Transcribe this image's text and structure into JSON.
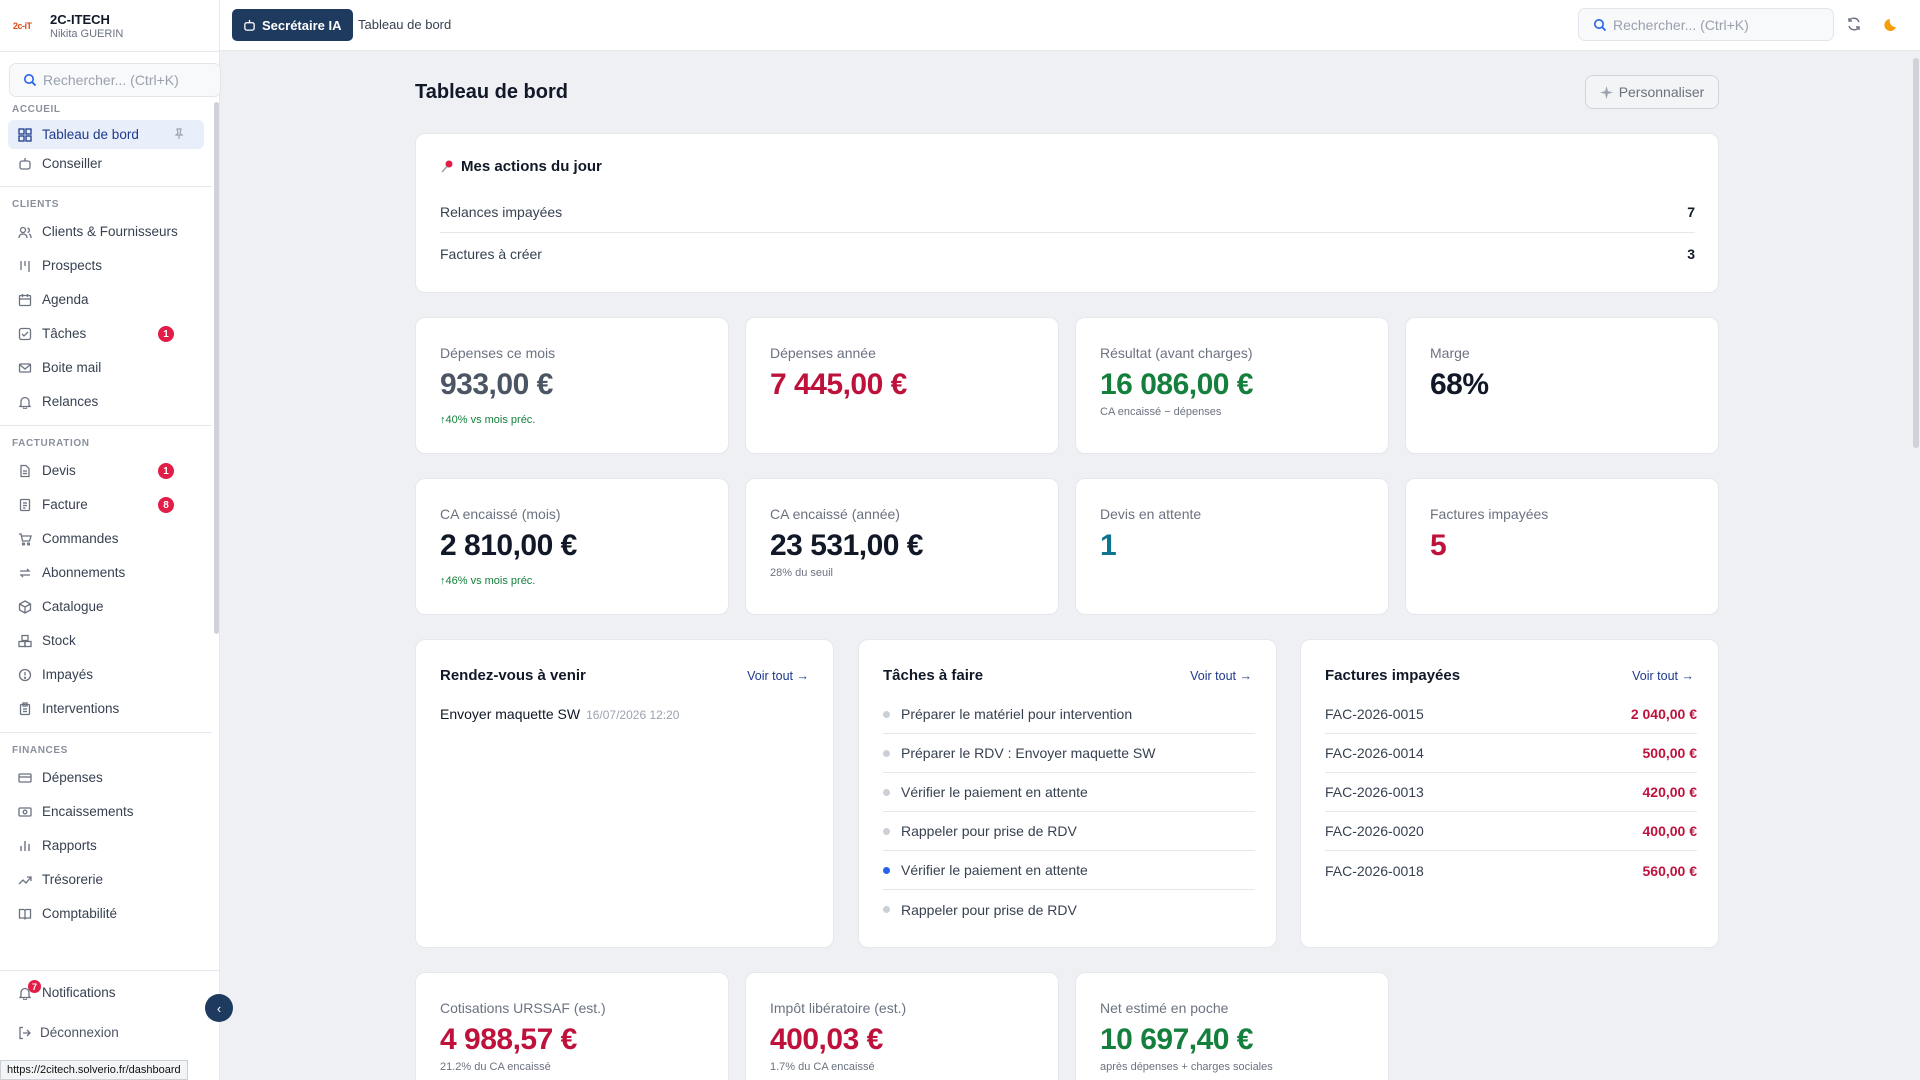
{
  "brand": {
    "name": "2C-ITECH",
    "user": "Nikita GUERIN",
    "logo": "2c-iT"
  },
  "sidebar": {
    "search_placeholder": "Rechercher... (Ctrl+K)",
    "sections": {
      "accueil": "Accueil",
      "clients": "Clients",
      "facturation": "Facturation",
      "finances": "Finances"
    },
    "items": {
      "tableau": "Tableau de bord",
      "conseiller": "Conseiller",
      "clients": "Clients & Fournisseurs",
      "prospects": "Prospects",
      "agenda": "Agenda",
      "taches": "Tâches",
      "taches_badge": "1",
      "boite": "Boite mail",
      "relances": "Relances",
      "devis": "Devis",
      "devis_badge": "1",
      "facture": "Facture",
      "facture_badge": "8",
      "commandes": "Commandes",
      "abonnements": "Abonnements",
      "catalogue": "Catalogue",
      "stock": "Stock",
      "impayes": "Impayés",
      "interventions": "Interventions",
      "depenses": "Dépenses",
      "encaissements": "Encaissements",
      "rapports": "Rapports",
      "tresorerie": "Trésorerie",
      "comptabilite": "Comptabilité"
    },
    "notifications": "Notifications",
    "notifications_badge": "7",
    "logout": "Déconnexion",
    "collapse": "‹"
  },
  "status_url": "https://2citech.solverio.fr/dashboard",
  "topbar": {
    "ai_button": "Secrétaire IA",
    "breadcrumb": "Tableau de bord",
    "search_placeholder": "Rechercher... (Ctrl+K)"
  },
  "main": {
    "title": "Tableau de bord",
    "customize": "Personnaliser",
    "actions": {
      "title": "Mes actions du jour",
      "rows": [
        {
          "label": "Relances impayées",
          "count": "7"
        },
        {
          "label": "Factures à créer",
          "count": "3"
        }
      ]
    },
    "kpis": [
      {
        "label": "Dépenses ce mois",
        "value": "933,00 €",
        "sub": "↑40% vs mois préc."
      },
      {
        "label": "Dépenses année",
        "value": "7 445,00 €",
        "sub": ""
      },
      {
        "label": "Résultat (avant charges)",
        "value": "16 086,00 €",
        "sub": "CA encaissé − dépenses"
      },
      {
        "label": "Marge",
        "value": "68%",
        "sub": ""
      },
      {
        "label": "CA encaissé (mois)",
        "value": "2 810,00 €",
        "sub": "↑46% vs mois préc."
      },
      {
        "label": "CA encaissé (année)",
        "value": "23 531,00 €",
        "sub": "28% du seuil"
      },
      {
        "label": "Devis en attente",
        "value": "1",
        "sub": ""
      },
      {
        "label": "Factures impayées",
        "value": "5",
        "sub": ""
      }
    ],
    "appointments": {
      "title": "Rendez-vous à venir",
      "see_all": "Voir tout →",
      "items": [
        {
          "label": "Envoyer maquette SW",
          "date": "16/07/2026 12:20"
        }
      ]
    },
    "tasks": {
      "title": "Tâches à faire",
      "see_all": "Voir tout →",
      "items": [
        "Préparer le matériel pour intervention",
        "Préparer le RDV : Envoyer maquette SW",
        "Vérifier le paiement en attente",
        "Rappeler pour prise de RDV",
        "Vérifier le paiement en attente",
        "Rappeler pour prise de RDV"
      ]
    },
    "unpaid": {
      "title": "Factures impayées",
      "see_all": "Voir tout →",
      "items": [
        {
          "ref": "FAC-2026-0015",
          "amount": "2 040,00 €"
        },
        {
          "ref": "FAC-2026-0014",
          "amount": "500,00 €"
        },
        {
          "ref": "FAC-2026-0013",
          "amount": "420,00 €"
        },
        {
          "ref": "FAC-2026-0020",
          "amount": "400,00 €"
        },
        {
          "ref": "FAC-2026-0018",
          "amount": "560,00 €"
        }
      ]
    },
    "fiscal": [
      {
        "label": "Cotisations URSSAF (est.)",
        "value": "4 988,57 €",
        "sub": "21.2% du CA encaissé"
      },
      {
        "label": "Impôt libératoire (est.)",
        "value": "400,03 €",
        "sub": "1.7% du CA encaissé"
      },
      {
        "label": "Net estimé en poche",
        "value": "10 697,40 €",
        "sub": "après dépenses + charges sociales"
      }
    ]
  },
  "colors": {
    "primary": "#1e3a5f",
    "negative": "#be123c",
    "positive": "#15803d",
    "badge": "#e11d48"
  }
}
